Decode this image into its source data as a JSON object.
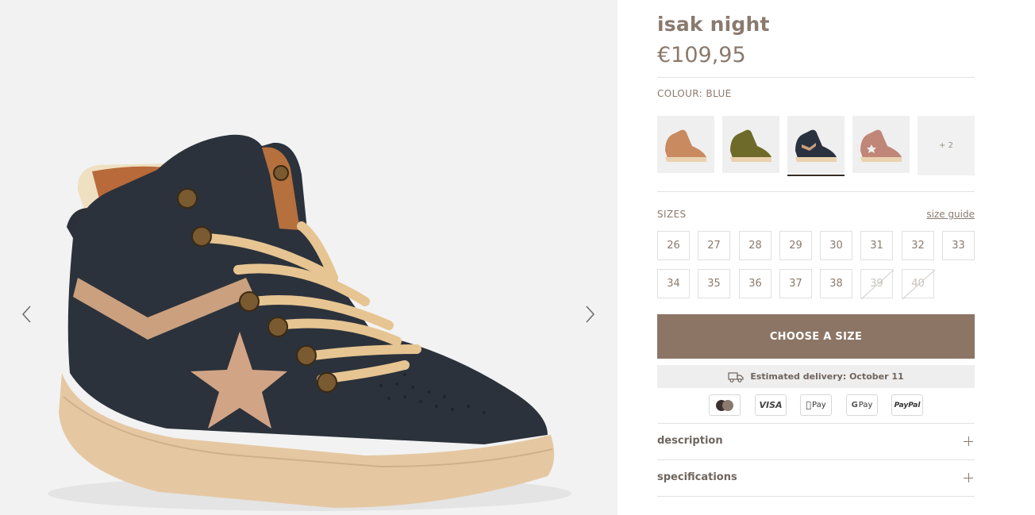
{
  "product": {
    "title": "isak night",
    "price": "€109,95",
    "colour_label": "COLOUR: BLUE"
  },
  "gallery": {
    "prev_icon": "chevron-left-icon",
    "next_icon": "chevron-right-icon",
    "image": "isak night sneaker"
  },
  "swatches": {
    "items": [
      {
        "name": "tan",
        "color": "#c88a5e"
      },
      {
        "name": "olive",
        "color": "#6e6a2a"
      },
      {
        "name": "night",
        "color": "#2a3240",
        "selected": true
      },
      {
        "name": "rose",
        "color": "#c08678"
      }
    ],
    "more_label": "+ 2"
  },
  "sizes": {
    "label": "SIZES",
    "guide_label": "size guide",
    "row1": [
      "26",
      "27",
      "28",
      "29",
      "30",
      "31",
      "32",
      "33"
    ],
    "row2": [
      "34",
      "35",
      "36",
      "37",
      "38",
      "39",
      "40"
    ],
    "unavailable": [
      "39",
      "40"
    ]
  },
  "cta": {
    "label": "CHOOSE A SIZE"
  },
  "delivery": {
    "icon": "truck-icon",
    "text": "Estimated delivery: October 11"
  },
  "payments": {
    "visa": "VISA",
    "applepay": "Pay",
    "gpay": "Pay",
    "paypal": "PayPal"
  },
  "accordions": {
    "description": "description",
    "specifications": "specifications"
  },
  "colors": {
    "accent": "#8c7565",
    "text": "#8a7a6e"
  }
}
